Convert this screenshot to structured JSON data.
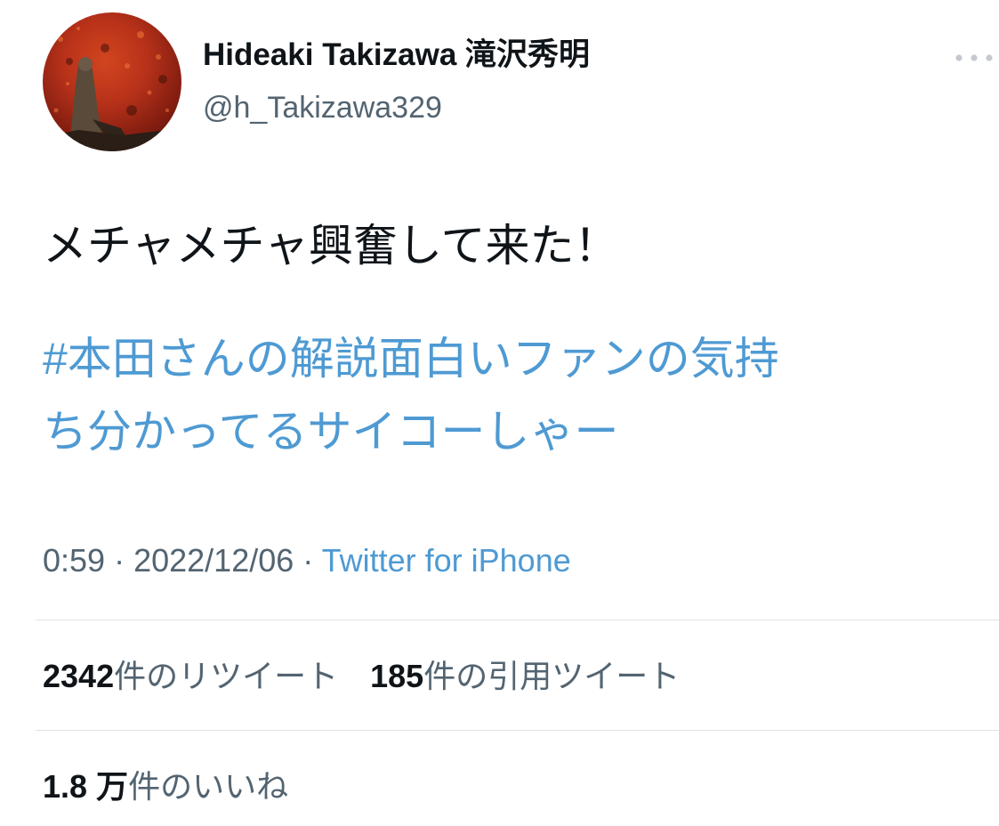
{
  "tweet": {
    "author": {
      "display_name": "Hideaki Takizawa 滝沢秀明",
      "handle": "@h_Takizawa329"
    },
    "text": "メチャメチャ興奮して来た！",
    "hashtag_line_1": "#本田さんの解説面白いファンの気持",
    "hashtag_line_2": "ち分かってるサイコーしゃー",
    "time": "0:59",
    "separator": " · ",
    "date": "2022/12/06",
    "source": "Twitter for iPhone"
  },
  "stats": {
    "retweets_count": "2342",
    "retweets_label": "件のリツイート",
    "quotes_count": "185",
    "quotes_label": "件の引用ツイート",
    "likes_count": "1.8 万",
    "likes_label": "件のいいね"
  },
  "icons": {
    "more": "more-dots-icon"
  },
  "colors": {
    "link": "#4e9ad3",
    "text": "#0f1419",
    "secondary": "#536471",
    "divider": "#dfe3e6"
  }
}
